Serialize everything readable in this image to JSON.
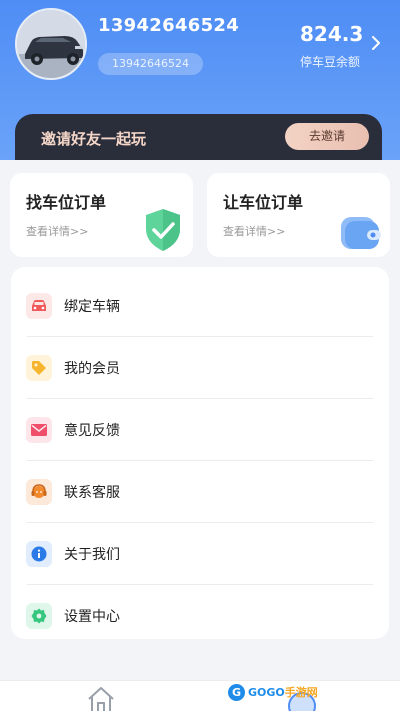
{
  "header": {
    "phone": "13942646524",
    "phone_pill": "13942646524",
    "balance_value": "824.3",
    "balance_label": "停车豆余额"
  },
  "invite": {
    "text": "邀请好友一起玩",
    "button": "去邀请"
  },
  "orders": [
    {
      "title": "找车位订单",
      "sub": "查看详情>>",
      "icon": "shield-check-icon"
    },
    {
      "title": "让车位订单",
      "sub": "查看详情>>",
      "icon": "wallet-icon"
    }
  ],
  "menu": [
    {
      "label": "绑定车辆",
      "icon": "car-icon",
      "color": "#f05a5a",
      "bg": "#fde8e8"
    },
    {
      "label": "我的会员",
      "icon": "tag-icon",
      "color": "#f5b52e",
      "bg": "#fff3d9"
    },
    {
      "label": "意见反馈",
      "icon": "mail-icon",
      "color": "#ef4f6a",
      "bg": "#fde6ea"
    },
    {
      "label": "联系客服",
      "icon": "headset-icon",
      "color": "#f28a2e",
      "bg": "#fde9da"
    },
    {
      "label": "关于我们",
      "icon": "info-icon",
      "color": "#2a7be8",
      "bg": "#e1edfd"
    },
    {
      "label": "设置中心",
      "icon": "gear-icon",
      "color": "#35c77e",
      "bg": "#def7ea"
    }
  ],
  "tabbar": {
    "home_icon": "home-icon"
  },
  "watermark": {
    "g": "G",
    "text_a": "GOGO",
    "text_b": "手游网"
  },
  "colors": {
    "header_blue": "#4f8df5",
    "invite_dark": "#2a2d3a",
    "invite_gold": "#f3d6c8"
  }
}
